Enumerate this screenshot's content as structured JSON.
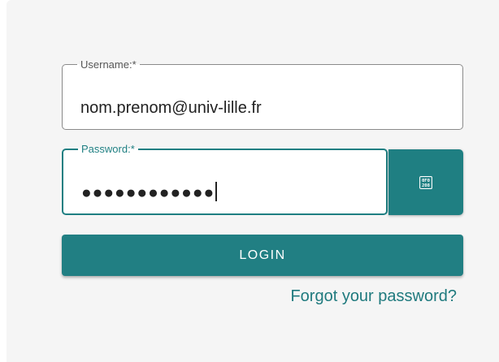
{
  "form": {
    "username": {
      "label": "Username:*",
      "value": "nom.prenom@univ-lille.fr"
    },
    "password": {
      "label": "Password:*",
      "masked_value": "●●●●●●●●●●●●"
    },
    "toggle_icon": "show-password-icon",
    "login_label": "LOGIN",
    "forgot_label": "Forgot your password?"
  },
  "colors": {
    "accent": "#1f7f82",
    "background": "#f5f5f5",
    "field_border": "#8a8a8a"
  }
}
